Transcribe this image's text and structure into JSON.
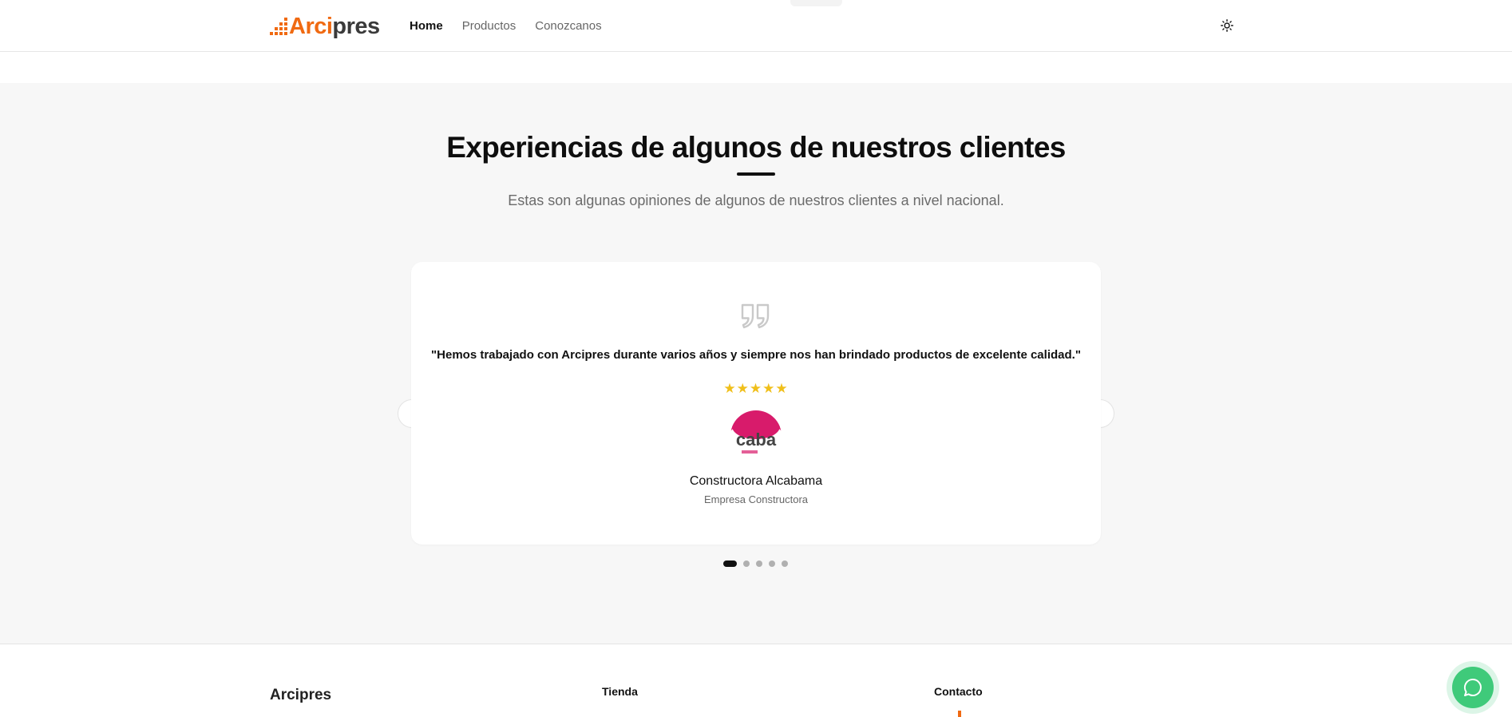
{
  "header": {
    "logo": {
      "part1": "Arci",
      "part2": "pres"
    },
    "nav": [
      {
        "label": "Home",
        "active": true
      },
      {
        "label": "Productos",
        "active": false
      },
      {
        "label": "Conozcanos",
        "active": false
      }
    ],
    "theme_toggle_icon": "sun-icon"
  },
  "testimonials": {
    "title": "Experiencias de algunos de nuestros clientes",
    "subtitle": "Estas son algunas opiniones de algunos de nuestros clientes a nivel nacional.",
    "current": {
      "quote": "\"Hemos trabajado con Arcipres durante varios años y siempre nos han brindado productos de excelente calidad.\"",
      "rating": 5,
      "stars": "★★★★★",
      "author_name": "Constructora Alcabama",
      "author_role": "Empresa Constructora",
      "avatar_text": "caba"
    },
    "slide_count": 5,
    "active_slide": 1
  },
  "footer": {
    "brand": "Arcipres",
    "col_tienda": "Tienda",
    "col_contacto": "Contacto"
  },
  "colors": {
    "brand_orange": "#f06a12",
    "star": "#f0bf1a",
    "chat_green": "#3fca7a"
  },
  "chat_icon": "chat-bubble-icon"
}
